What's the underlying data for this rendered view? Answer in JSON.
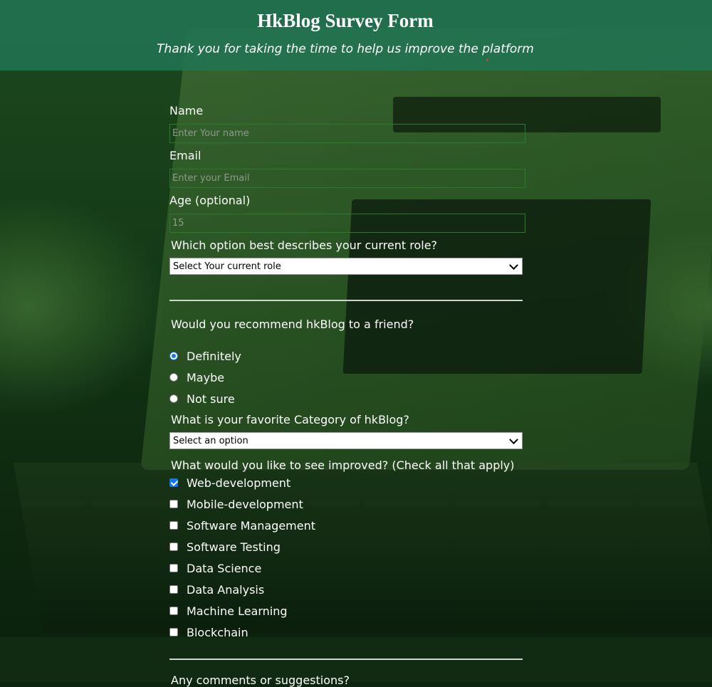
{
  "header": {
    "title": "HkBlog Survey Form",
    "subtitle": "Thank you for taking the time to help us improve the platform"
  },
  "form": {
    "name": {
      "label": "Name",
      "placeholder": "Enter Your name",
      "value": ""
    },
    "email": {
      "label": "Email",
      "placeholder": "Enter your Email",
      "value": ""
    },
    "age": {
      "label": "Age (optional)",
      "placeholder": "15",
      "value": ""
    },
    "role": {
      "label": "Which option best describes your current role?",
      "selected": "Select Your current role"
    },
    "recommend": {
      "question": "Would you recommend hkBlog to a friend?",
      "options": [
        {
          "label": "Definitely",
          "checked": true
        },
        {
          "label": "Maybe",
          "checked": false
        },
        {
          "label": "Not sure",
          "checked": false
        }
      ]
    },
    "category": {
      "label": "What is your favorite Category of hkBlog?",
      "selected": "Select an option"
    },
    "improvements": {
      "question": "What would you like to see improved? (Check all that apply)",
      "options": [
        {
          "label": "Web-development",
          "checked": true
        },
        {
          "label": "Mobile-development",
          "checked": false
        },
        {
          "label": "Software Management",
          "checked": false
        },
        {
          "label": "Software Testing",
          "checked": false
        },
        {
          "label": "Data Science",
          "checked": false
        },
        {
          "label": "Data Analysis",
          "checked": false
        },
        {
          "label": "Machine Learning",
          "checked": false
        },
        {
          "label": "Blockchain",
          "checked": false
        }
      ]
    },
    "comments": {
      "label": "Any comments or suggestions?"
    }
  },
  "colors": {
    "header_bg": "#217352",
    "accent": "#1a73e8",
    "field_border": "#2c7a2e"
  }
}
